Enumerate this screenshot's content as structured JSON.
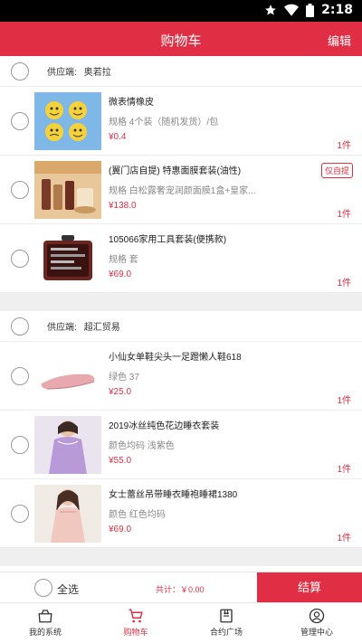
{
  "status_bar": {
    "time": "2:18"
  },
  "header": {
    "title": "购物车",
    "edit_label": "编辑"
  },
  "groups": [
    {
      "supplier_label": "供应端:",
      "supplier_name": "奥若拉",
      "items": [
        {
          "name": "微表情橡皮",
          "spec": "规格 4个装（随机发货）/包",
          "price": "¥0.4",
          "qty": "1件",
          "tag": ""
        },
        {
          "name": "(翼门店自提) 特惠面膜套装(油性)",
          "spec": "规格 白松露奢宠润颜面膜1盒+皇家...",
          "price": "¥138.0",
          "qty": "1件",
          "tag": "仅自提"
        },
        {
          "name": "105066家用工具套装(便携款)",
          "spec": "规格 套",
          "price": "¥69.0",
          "qty": "1件",
          "tag": ""
        }
      ]
    },
    {
      "supplier_label": "供应端:",
      "supplier_name": "超汇贸易",
      "items": [
        {
          "name": "小仙女单鞋尖头一足蹬懒人鞋618",
          "spec": "绿色 37",
          "price": "¥25.0",
          "qty": "1件",
          "tag": ""
        },
        {
          "name": "2019冰丝纯色花边睡衣套装",
          "spec": "颜色均码 浅紫色",
          "price": "¥55.0",
          "qty": "1件",
          "tag": ""
        },
        {
          "name": "女士蕾丝吊带睡衣睡袍睡裙1380",
          "spec": "颜色 红色均码",
          "price": "¥69.0",
          "qty": "1件",
          "tag": ""
        }
      ]
    }
  ],
  "action_bar": {
    "select_all": "全选",
    "total": "共计：￥0.00",
    "checkout": "结算"
  },
  "tabs": [
    {
      "label": "我的系统",
      "icon": "system-icon",
      "active": false
    },
    {
      "label": "购物车",
      "icon": "cart-icon",
      "active": true
    },
    {
      "label": "合约广场",
      "icon": "contract-icon",
      "active": false
    },
    {
      "label": "管理中心",
      "icon": "user-icon",
      "active": false
    }
  ],
  "colors": {
    "accent": "#e02f44",
    "background": "#f2f2f2"
  }
}
